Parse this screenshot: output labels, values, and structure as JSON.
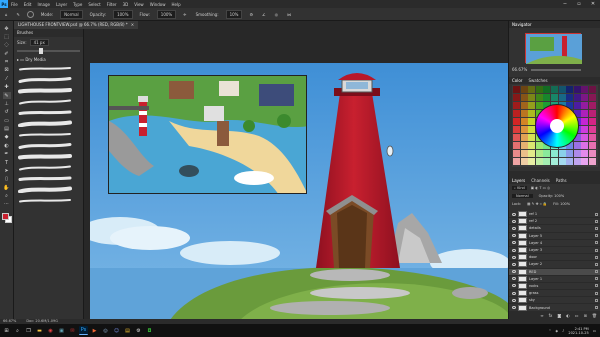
{
  "app": {
    "name_short": "Ps",
    "menus": [
      "File",
      "Edit",
      "Image",
      "Layer",
      "Type",
      "Select",
      "Filter",
      "3D",
      "View",
      "Window",
      "Help"
    ],
    "window_controls": [
      "minimize-icon",
      "maximize-icon",
      "close-icon"
    ]
  },
  "options_bar": {
    "mode_label": "Mode:",
    "mode_value": "Normal",
    "opacity_label": "Opacity:",
    "opacity_value": "100%",
    "flow_label": "Flow:",
    "flow_value": "100%",
    "smoothing_label": "Smoothing:",
    "smoothing_value": "10%"
  },
  "document_tab": {
    "title": "LIGHTHOUSE FRONTVIEW.psd @ 66.7% (RED, RGB/8) *",
    "close": "×"
  },
  "toolbar": {
    "tools": [
      "move-tool-icon",
      "marquee-tool-icon",
      "lasso-tool-icon",
      "quick-select-icon",
      "crop-tool-icon",
      "frame-tool-icon",
      "eyedropper-icon",
      "healing-brush-icon",
      "brush-tool-icon",
      "clone-stamp-icon",
      "history-brush-icon",
      "eraser-tool-icon",
      "gradient-tool-icon",
      "blur-tool-icon",
      "dodge-tool-icon",
      "pen-tool-icon",
      "type-tool-icon",
      "path-select-icon",
      "rectangle-tool-icon",
      "hand-tool-icon",
      "zoom-tool-icon",
      "more-tools-icon"
    ],
    "active_tool_index": 8,
    "foreground_color": "#c8202f",
    "background_color": "#ffffff"
  },
  "brush_panel": {
    "title": "Brushes",
    "size_label": "Size:",
    "size_value": "41 px",
    "size_fraction": 0.35,
    "folder_label": "Dry Media",
    "stroke_count": 13
  },
  "right_panels": {
    "navigator_title": "Navigator",
    "navigator_zoom": "66.67%",
    "swatches_tabs": [
      "Color",
      "Swatches"
    ],
    "layers_tabs": [
      "Layers",
      "Channels",
      "Paths"
    ],
    "blend_mode": "Normal",
    "opacity_label": "Opacity: 100%",
    "fill_label": "Fill: 100%",
    "lock_label": "Lock:"
  },
  "layers": [
    {
      "name": "ref 1",
      "selected": false
    },
    {
      "name": "ref 2",
      "selected": false
    },
    {
      "name": "details",
      "selected": false
    },
    {
      "name": "Layer 5",
      "selected": false
    },
    {
      "name": "Layer 4",
      "selected": false
    },
    {
      "name": "Layer 3",
      "selected": false
    },
    {
      "name": "door",
      "selected": false
    },
    {
      "name": "Layer 2",
      "selected": false
    },
    {
      "name": "RED",
      "selected": true
    },
    {
      "name": "Layer 1",
      "selected": false
    },
    {
      "name": "rocks",
      "selected": false
    },
    {
      "name": "grass",
      "selected": false
    },
    {
      "name": "sky",
      "selected": false
    },
    {
      "name": "Background",
      "selected": false
    }
  ],
  "status_bar": {
    "zoom": "66.67%",
    "doc_info": "Doc: 20.6M/1.09G"
  },
  "taskbar": {
    "start_icon": "windows-start-icon",
    "apps": [
      "search-icon",
      "task-view-icon",
      "file-explorer-icon",
      "chrome-icon",
      "store-icon",
      "mail-icon",
      "photoshop-icon",
      "media-player-icon",
      "steam-icon",
      "discord-icon",
      "notes-icon",
      "settings-icon",
      "camera-icon"
    ],
    "time": "2:41 PM",
    "date": "2021-10-25"
  },
  "swatch_colors": [
    "#ff0000",
    "#ff8000",
    "#ffff00",
    "#80ff00",
    "#00ff00",
    "#00ff80",
    "#00ffff",
    "#0080ff",
    "#0000ff",
    "#8000ff",
    "#ff00ff",
    "#ff0080"
  ]
}
